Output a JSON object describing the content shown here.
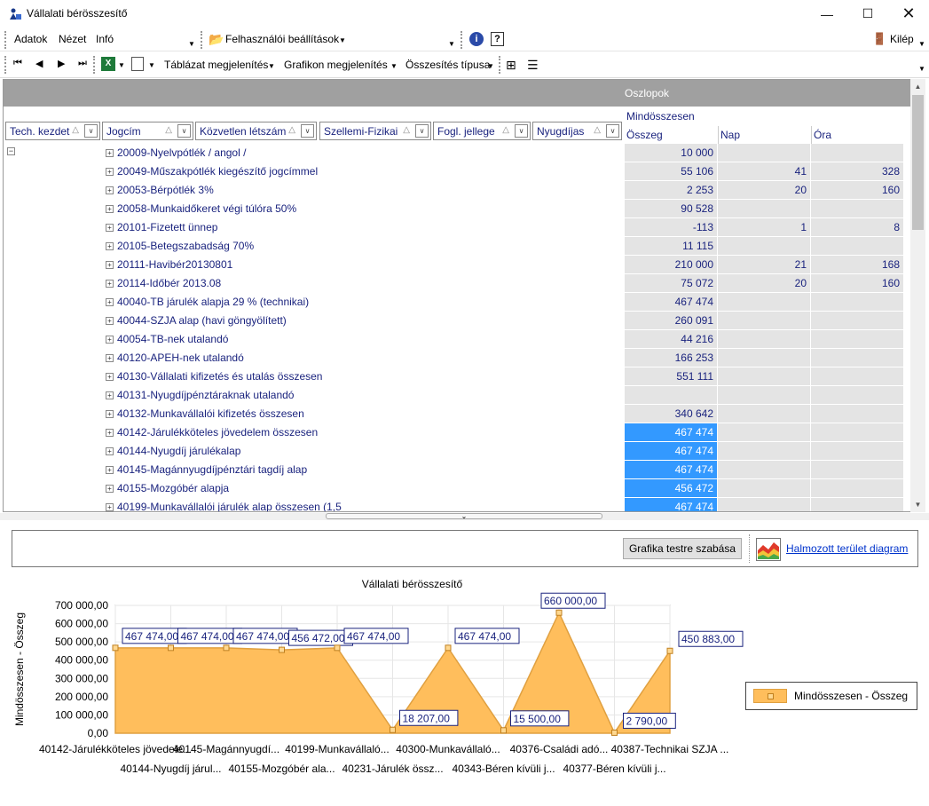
{
  "window": {
    "title": "Vállalati bérösszesítő"
  },
  "menu": {
    "items": [
      "Adatok",
      "Nézet",
      "Infó"
    ],
    "settings": "Felhasználói beállítások",
    "exit": "Kilép"
  },
  "toolbar": {
    "table_view": "Táblázat megjelenítés",
    "chart_view": "Grafikon megjelenítés",
    "sum_type": "Összesítés típusa"
  },
  "grid": {
    "column_group": "Oszlopok",
    "measure_header": "Mindösszesen",
    "sub_columns": [
      "Összeg",
      "Nap",
      "Óra"
    ],
    "field_buttons": [
      "Tech. kezdet",
      "Jogcím",
      "Közvetlen létszám",
      "Szellemi-Fizikai",
      "Fogl. jellege",
      "Nyugdíjas"
    ],
    "rows": [
      {
        "label": "20009-Nyelvpótlék / angol /",
        "osszeg": "10 000",
        "nap": "",
        "ora": "",
        "sel": false
      },
      {
        "label": "20049-Műszakpótlék kiegészítő jogcímmel",
        "osszeg": "55 106",
        "nap": "41",
        "ora": "328",
        "sel": false
      },
      {
        "label": "20053-Bérpótlék 3%",
        "osszeg": "2 253",
        "nap": "20",
        "ora": "160",
        "sel": false
      },
      {
        "label": "20058-Munkaidőkeret végi túlóra 50%",
        "osszeg": "90 528",
        "nap": "",
        "ora": "",
        "sel": false
      },
      {
        "label": "20101-Fizetett ünnep",
        "osszeg": "-113",
        "nap": "1",
        "ora": "8",
        "sel": false
      },
      {
        "label": "20105-Betegszabadság 70%",
        "osszeg": "11 115",
        "nap": "",
        "ora": "",
        "sel": false
      },
      {
        "label": "20111-Havibér20130801",
        "osszeg": "210 000",
        "nap": "21",
        "ora": "168",
        "sel": false
      },
      {
        "label": "20114-Időbér 2013.08",
        "osszeg": "75 072",
        "nap": "20",
        "ora": "160",
        "sel": false
      },
      {
        "label": "40040-TB járulék alapja 29 % (technikai)",
        "osszeg": "467 474",
        "nap": "",
        "ora": "",
        "sel": false
      },
      {
        "label": "40044-SZJA alap (havi göngyölített)",
        "osszeg": "260 091",
        "nap": "",
        "ora": "",
        "sel": false
      },
      {
        "label": "40054-TB-nek utalandó",
        "osszeg": "44 216",
        "nap": "",
        "ora": "",
        "sel": false
      },
      {
        "label": "40120-APEH-nek utalandó",
        "osszeg": "166 253",
        "nap": "",
        "ora": "",
        "sel": false
      },
      {
        "label": "40130-Vállalati kifizetés és utalás összesen",
        "osszeg": "551 111",
        "nap": "",
        "ora": "",
        "sel": false
      },
      {
        "label": "40131-Nyugdíjpénztáraknak utalandó",
        "osszeg": "",
        "nap": "",
        "ora": "",
        "sel": false
      },
      {
        "label": "40132-Munkavállalói kifizetés összesen",
        "osszeg": "340 642",
        "nap": "",
        "ora": "",
        "sel": false
      },
      {
        "label": "40142-Járulékköteles jövedelem összesen",
        "osszeg": "467 474",
        "nap": "",
        "ora": "",
        "sel": true
      },
      {
        "label": "40144-Nyugdíj járulékalap",
        "osszeg": "467 474",
        "nap": "",
        "ora": "",
        "sel": true
      },
      {
        "label": "40145-Magánnyugdíjpénztári tagdíj alap",
        "osszeg": "467 474",
        "nap": "",
        "ora": "",
        "sel": true
      },
      {
        "label": "40155-Mozgóbér alapja",
        "osszeg": "456 472",
        "nap": "",
        "ora": "",
        "sel": true
      },
      {
        "label": "40199-Munkavállalói járulék alap összesen (1,5",
        "osszeg": "467 474",
        "nap": "",
        "ora": "",
        "sel": true
      }
    ]
  },
  "chart_toolbar": {
    "customize": "Grafika testre szabása",
    "chart_type": "Halmozott terület diagram"
  },
  "colors": {
    "area_fill": "#ffbe5c",
    "area_stroke": "#e0a040",
    "selection": "#3399ff",
    "link": "#0033cc",
    "text_blue": "#1a237e"
  },
  "chart_data": {
    "type": "area",
    "title": "Vállalati bérösszesítő",
    "ylabel": "Mindösszesen - Összeg",
    "ylim": [
      0,
      700000
    ],
    "yticks": [
      "0,00",
      "100 000,00",
      "200 000,00",
      "300 000,00",
      "400 000,00",
      "500 000,00",
      "600 000,00",
      "700 000,00"
    ],
    "legend": "Mindösszesen - Összeg",
    "categories_top": [
      "40142-Járulékköteles jövedele...",
      "40145-Magánnyugdí...",
      "40199-Munkavállaló...",
      "40300-Munkavállaló...",
      "40376-Családi adó...",
      "40387-Technikai SZJA ..."
    ],
    "categories_bottom": [
      "40144-Nyugdíj járul...",
      "40155-Mozgóbér ala...",
      "40231-Járulék össz...",
      "40343-Béren kívüli j...",
      "40377-Béren kívüli j..."
    ],
    "values": [
      467474,
      467474,
      467474,
      456472,
      467474,
      18207,
      467474,
      15500,
      660000,
      2790,
      450883
    ],
    "value_labels": [
      "467 474,00",
      "467 474,00",
      "467 474,00",
      "456 472,00",
      "467 474,00",
      "18 207,00",
      "467 474,00",
      "15 500,00",
      "660 000,00",
      "2 790,00",
      "450 883,00"
    ]
  }
}
